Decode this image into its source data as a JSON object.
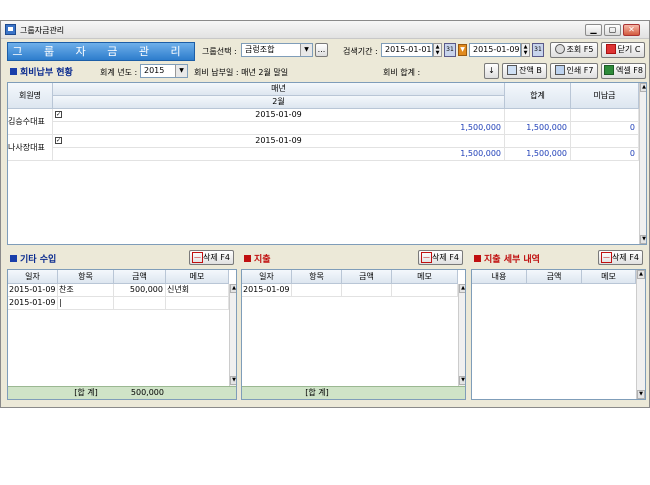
{
  "window": {
    "title": "그룹자금관리"
  },
  "banner": {
    "title": "그 룹 자 금 관 리"
  },
  "toolbar": {
    "group_label": "그룹선택 :",
    "group_value": "금렁조합",
    "group_more": "...",
    "period_label": "검색기간 :",
    "date_from": "2015-01-01",
    "date_to": "2015-01-09",
    "search_btn": "조회 F5",
    "close_btn": "닫기 C"
  },
  "dues": {
    "title": "회비납부 현황",
    "year_label": "회계 년도 :",
    "year_value": "2015",
    "pay_day": "회비 납부일 : 매년 2월 말일",
    "total_label": "회비 합계 :",
    "down_btn": "↓",
    "balance_btn": "잔액 B",
    "print_btn": "인쇄 F7",
    "excel_btn": "엑셀 F8",
    "headers": {
      "member": "회원명",
      "yearly": "매년",
      "month": "2월",
      "sum": "합계",
      "unpaid": "미납금"
    },
    "rows": [
      {
        "name": "김승수대표",
        "date": "2015-01-09",
        "amount": "1,500,000",
        "sum": "1,500,000",
        "unpaid": "0"
      },
      {
        "name": "나사장대표",
        "date": "2015-01-09",
        "amount": "1,500,000",
        "sum": "1,500,000",
        "unpaid": "0"
      }
    ]
  },
  "income": {
    "title": "기타 수입",
    "delete_btn": "삭제 F4",
    "headers": [
      "일자",
      "항목",
      "금액",
      "메모"
    ],
    "rows": [
      {
        "date": "2015-01-09",
        "item": "찬조",
        "amount": "500,000",
        "memo": "신년회"
      },
      {
        "date": "2015-01-09",
        "item": "",
        "amount": "",
        "memo": ""
      }
    ],
    "total_label": "[합 계]",
    "total_value": "500,000"
  },
  "expense": {
    "title": "지출",
    "delete_btn": "삭제 F4",
    "headers": [
      "일자",
      "항목",
      "금액",
      "메모"
    ],
    "rows": [
      {
        "date": "2015-01-09"
      }
    ],
    "total_label": "[합 계]"
  },
  "detail": {
    "title": "지출 세부 내역",
    "delete_btn": "삭제 F4",
    "headers": [
      "내용",
      "금액",
      "메모"
    ]
  }
}
